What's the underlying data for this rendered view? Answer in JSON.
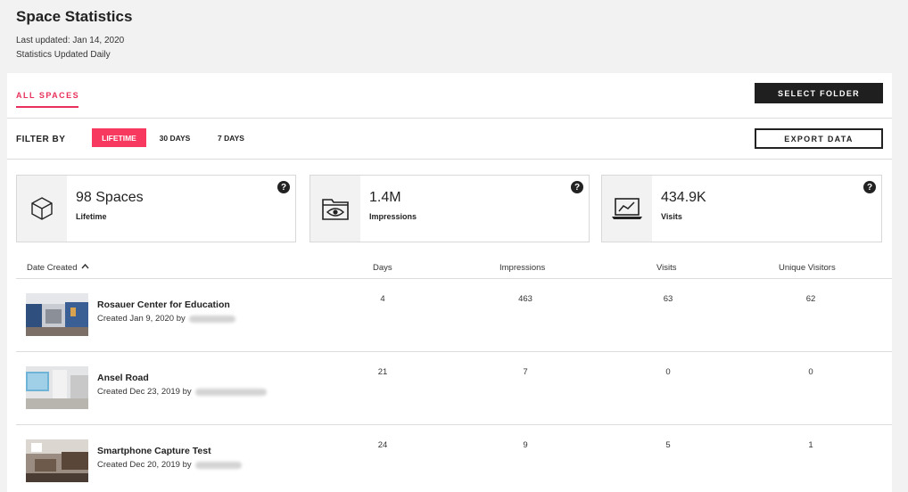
{
  "header": {
    "title": "Space Statistics",
    "last_updated": "Last updated: Jan 14, 2020",
    "update_frequency": "Statistics Updated Daily"
  },
  "tabs": [
    {
      "label": "ALL SPACES",
      "active": true
    }
  ],
  "toolbar": {
    "select_folder_label": "SELECT FOLDER",
    "export_data_label": "EXPORT DATA"
  },
  "filter": {
    "label": "FILTER BY",
    "options": [
      {
        "label": "LIFETIME",
        "active": true
      },
      {
        "label": "30 DAYS",
        "active": false
      },
      {
        "label": "7 DAYS",
        "active": false
      }
    ]
  },
  "stats": [
    {
      "value": "98 Spaces",
      "label": "Lifetime",
      "icon": "cube-icon"
    },
    {
      "value": "1.4M",
      "label": "Impressions",
      "icon": "eye-folder-icon"
    },
    {
      "value": "434.9K",
      "label": "Visits",
      "icon": "laptop-chart-icon"
    }
  ],
  "help_glyph": "?",
  "table": {
    "columns": {
      "date_created": "Date Created",
      "days": "Days",
      "impressions": "Impressions",
      "visits": "Visits",
      "unique_visitors": "Unique Visitors"
    },
    "sort_indicator": "^",
    "rows": [
      {
        "name": "Rosauer Center for Education",
        "created": "Created Jan 9, 2020 by",
        "days": "4",
        "impressions": "463",
        "visits": "63",
        "unique_visitors": "62"
      },
      {
        "name": "Ansel Road",
        "created": "Created Dec 23, 2019 by",
        "days": "21",
        "impressions": "7",
        "visits": "0",
        "unique_visitors": "0"
      },
      {
        "name": "Smartphone Capture Test",
        "created": "Created Dec 20, 2019 by",
        "days": "24",
        "impressions": "9",
        "visits": "5",
        "unique_visitors": "1"
      }
    ]
  },
  "colors": {
    "accent": "#f7385f",
    "dark": "#1f1f1f",
    "background": "#f2f2f2"
  }
}
